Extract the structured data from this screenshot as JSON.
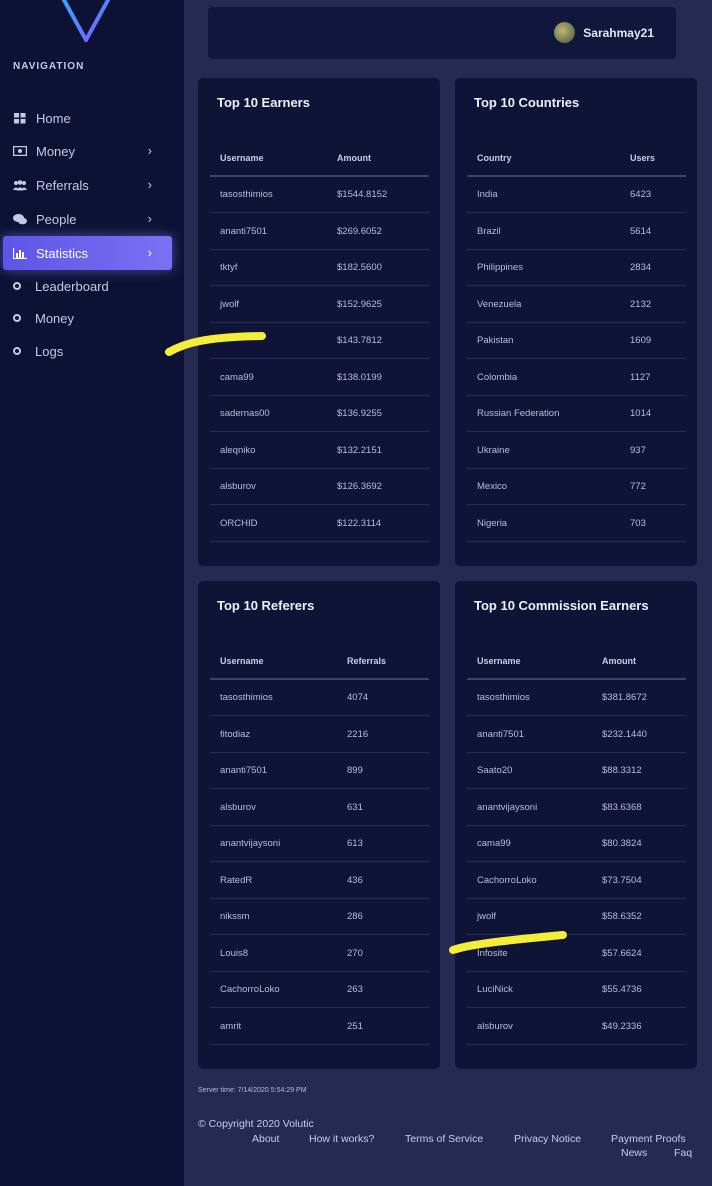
{
  "nav": {
    "heading": "NAVIGATION",
    "items": [
      {
        "label": "Home",
        "icon": "grid-icon"
      },
      {
        "label": "Money",
        "icon": "money-icon"
      },
      {
        "label": "Referrals",
        "icon": "users-icon"
      },
      {
        "label": "People",
        "icon": "chat-icon"
      },
      {
        "label": "Statistics",
        "icon": "bar-chart-icon",
        "active": true
      }
    ],
    "subitems": [
      "Leaderboard",
      "Money",
      "Logs"
    ],
    "accent_color": "#6a61ec"
  },
  "header": {
    "username": "Sarahmay21"
  },
  "cards": {
    "earners": {
      "title": "Top 10 Earners",
      "col1": "Username",
      "col2": "Amount",
      "rows": [
        [
          "tasosthimios",
          "$1544.8152"
        ],
        [
          "ananti7501",
          "$269.6052"
        ],
        [
          "tktyf",
          "$182.5600"
        ],
        [
          "jwolf",
          "$152.9625"
        ],
        [
          "",
          "$143.7812"
        ],
        [
          "cama99",
          "$138.0199"
        ],
        [
          "sadernas00",
          "$136.9255"
        ],
        [
          "aleqniko",
          "$132.2151"
        ],
        [
          "alsburov",
          "$126.3692"
        ],
        [
          "ORCHID",
          "$122.3114"
        ]
      ]
    },
    "countries": {
      "title": "Top 10 Countries",
      "col1": "Country",
      "col2": "Users",
      "rows": [
        [
          "India",
          "6423"
        ],
        [
          "Brazil",
          "5614"
        ],
        [
          "Philippines",
          "2834"
        ],
        [
          "Venezuela",
          "2132"
        ],
        [
          "Pakistan",
          "1609"
        ],
        [
          "Colombia",
          "1127"
        ],
        [
          "Russian Federation",
          "1014"
        ],
        [
          "Ukraine",
          "937"
        ],
        [
          "Mexico",
          "772"
        ],
        [
          "Nigeria",
          "703"
        ]
      ]
    },
    "referers": {
      "title": "Top 10 Referers",
      "col1": "Username",
      "col2": "Referrals",
      "rows": [
        [
          "tasosthimios",
          "4074"
        ],
        [
          "fitodiaz",
          "2216"
        ],
        [
          "ananti7501",
          "899"
        ],
        [
          "alsburov",
          "631"
        ],
        [
          "anantvijaysoni",
          "613"
        ],
        [
          "RatedR",
          "436"
        ],
        [
          "nikssm",
          "286"
        ],
        [
          "Louis8",
          "270"
        ],
        [
          "CachorroLoko",
          "263"
        ],
        [
          "amrit",
          "251"
        ]
      ]
    },
    "commission": {
      "title": "Top 10 Commission Earners",
      "col1": "Username",
      "col2": "Amount",
      "rows": [
        [
          "tasosthimios",
          "$381.8672"
        ],
        [
          "ananti7501",
          "$232.1440"
        ],
        [
          "Saato20",
          "$88.3312"
        ],
        [
          "anantvijaysoni",
          "$83.6368"
        ],
        [
          "cama99",
          "$80.3824"
        ],
        [
          "CachorroLoko",
          "$73.7504"
        ],
        [
          "jwolf",
          "$58.6352"
        ],
        [
          "Infosite",
          "$57.6624"
        ],
        [
          "LuciNick",
          "$55.4736"
        ],
        [
          "alsburov",
          "$49.2336"
        ]
      ]
    }
  },
  "footer": {
    "server_time": "Server time: 7/14/2020 5:54:29 PM",
    "copyright": "© Copyright 2020 Volutic",
    "links": [
      "About",
      "How it works?",
      "Terms of Service",
      "Privacy Notice",
      "Payment Proofs",
      "News",
      "Faq"
    ]
  },
  "annotation_color": "#f4ee3a"
}
